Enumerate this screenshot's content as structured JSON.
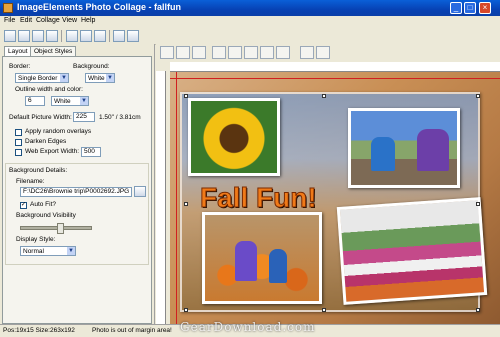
{
  "window": {
    "title": "ImageElements Photo Collage - fallfun"
  },
  "menu": [
    "File",
    "Edit",
    "Collage",
    "View",
    "Help"
  ],
  "tabs": [
    "Layout",
    "Object Styles"
  ],
  "layout": {
    "border_label": "Border:",
    "border_value": "Single Border",
    "background_label": "Background:",
    "background_value": "White",
    "outline_label": "Outline width and color:",
    "outline_width": "6",
    "outline_color": "White",
    "default_width_label": "Default Picture Width:",
    "default_width_value": "225",
    "default_width_units": "1.50\" / 3.81cm",
    "apply_random_overlays": "Apply random overlays",
    "darken_edges": "Darken Edges",
    "web_export_label": "Web Export Width:",
    "web_export_value": "500"
  },
  "background_details": {
    "heading": "Background Details:",
    "filename_label": "Filename:",
    "filename_value": "F:\\DC26\\Brownie trip\\P0002692.JPG",
    "auto_fit": "Auto Fit?",
    "visibility_label": "Background Visibility",
    "visibility_level": 0.55,
    "display_style_label": "Display Style:",
    "display_style_value": "Normal"
  },
  "collage": {
    "headline": "Fall Fun!"
  },
  "status": {
    "position": "Pos:19x15 Size:263x192",
    "message": "Photo is out of margin area!"
  },
  "watermark": "GearDownload.com",
  "colors": {
    "accent": "#0a5fd8",
    "headline": "#f07a18",
    "margin_line": "#d02020"
  }
}
